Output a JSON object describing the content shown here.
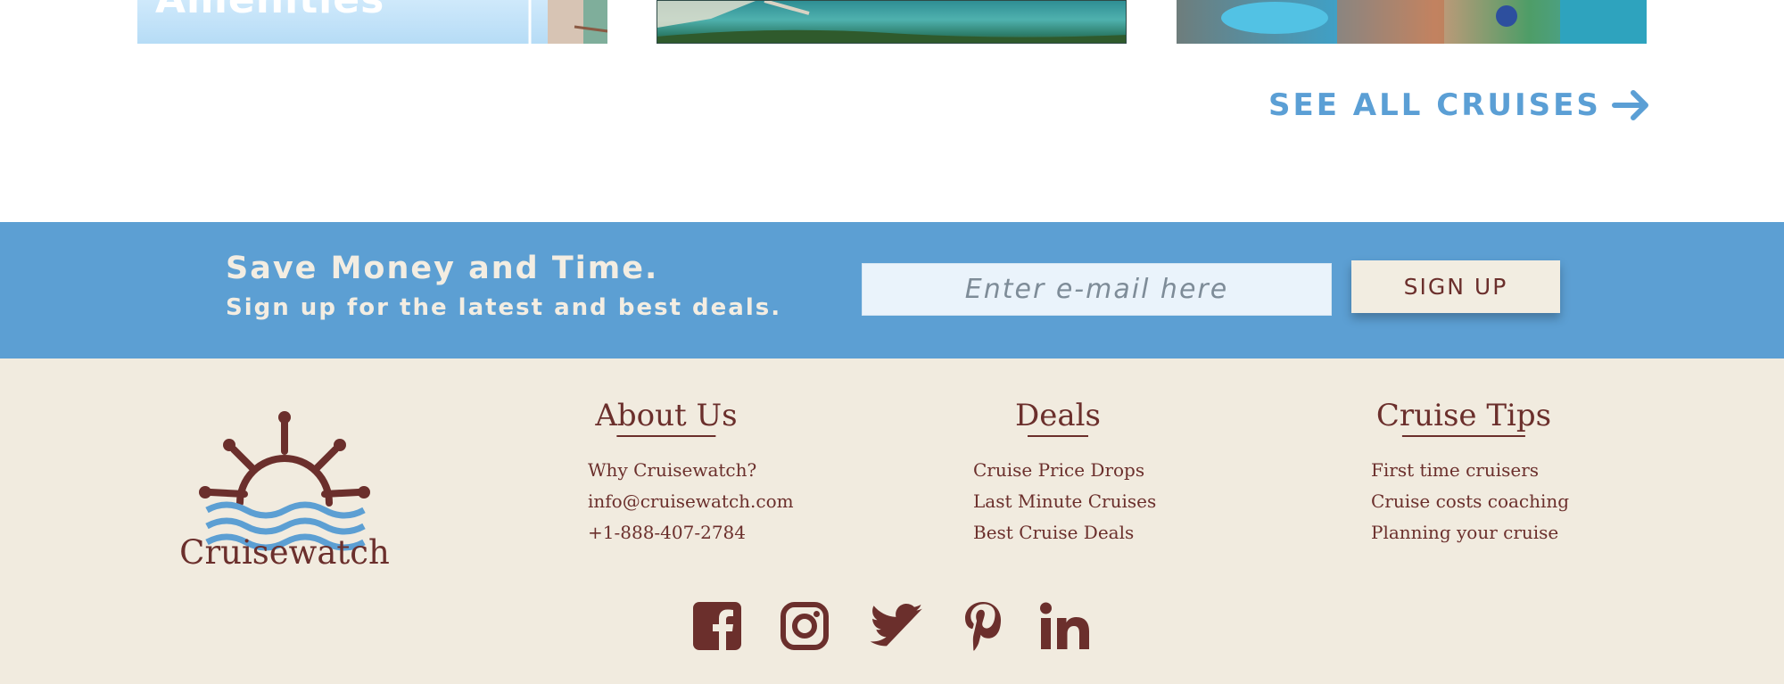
{
  "cards": [
    {
      "title": "Amenities"
    },
    {
      "title": ""
    },
    {
      "title": ""
    }
  ],
  "see_all": {
    "label": "SEE ALL CRUISES",
    "icon": "arrow-right-icon"
  },
  "signup": {
    "headline": "Save Money and Time.",
    "subline": "Sign up for the latest and best deals.",
    "email_placeholder": "Enter e-mail here",
    "button_label": "SIGN UP"
  },
  "footer": {
    "brand": "Cruisewatch",
    "columns": {
      "about": {
        "heading": "About Us",
        "links": [
          "Why Cruisewatch?",
          "info@cruisewatch.com",
          "+1-888-407-2784"
        ]
      },
      "deals": {
        "heading": "Deals",
        "links": [
          "Cruise Price Drops",
          "Last Minute Cruises",
          "Best Cruise Deals"
        ]
      },
      "tips": {
        "heading": "Cruise Tips",
        "links": [
          "First time cruisers",
          "Cruise costs coaching",
          "Planning your cruise"
        ]
      }
    },
    "social": [
      "facebook-icon",
      "instagram-icon",
      "twitter-icon",
      "pinterest-icon",
      "linkedin-icon"
    ]
  },
  "colors": {
    "accent_blue": "#5c9fd3",
    "brand_maroon": "#6b2f2c",
    "cream": "#f1ebdf"
  }
}
